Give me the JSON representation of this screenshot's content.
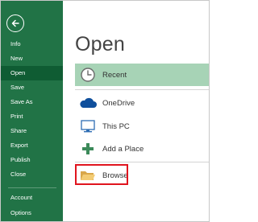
{
  "sidebar": {
    "back_label": "",
    "items": [
      {
        "label": "Info"
      },
      {
        "label": "New"
      },
      {
        "label": "Open"
      },
      {
        "label": "Save"
      },
      {
        "label": "Save As"
      },
      {
        "label": "Print"
      },
      {
        "label": "Share"
      },
      {
        "label": "Export"
      },
      {
        "label": "Publish"
      },
      {
        "label": "Close"
      },
      {
        "label": "Account"
      },
      {
        "label": "Options"
      }
    ],
    "active_item": "Open"
  },
  "main": {
    "title": "Open",
    "places": [
      {
        "label": "Recent",
        "icon": "clock-icon"
      },
      {
        "label": "OneDrive",
        "icon": "cloud-icon"
      },
      {
        "label": "This PC",
        "icon": "computer-icon"
      },
      {
        "label": "Add a Place",
        "icon": "plus-icon"
      },
      {
        "label": "Browse",
        "icon": "folder-icon"
      }
    ],
    "selected_place": "Recent",
    "highlighted_place": "Browse"
  },
  "colors": {
    "sidebar_bg": "#217346",
    "active_item_bg": "#0f5c33",
    "selected_place_bg": "#a7d3b6",
    "highlight_border": "#e0141e"
  }
}
